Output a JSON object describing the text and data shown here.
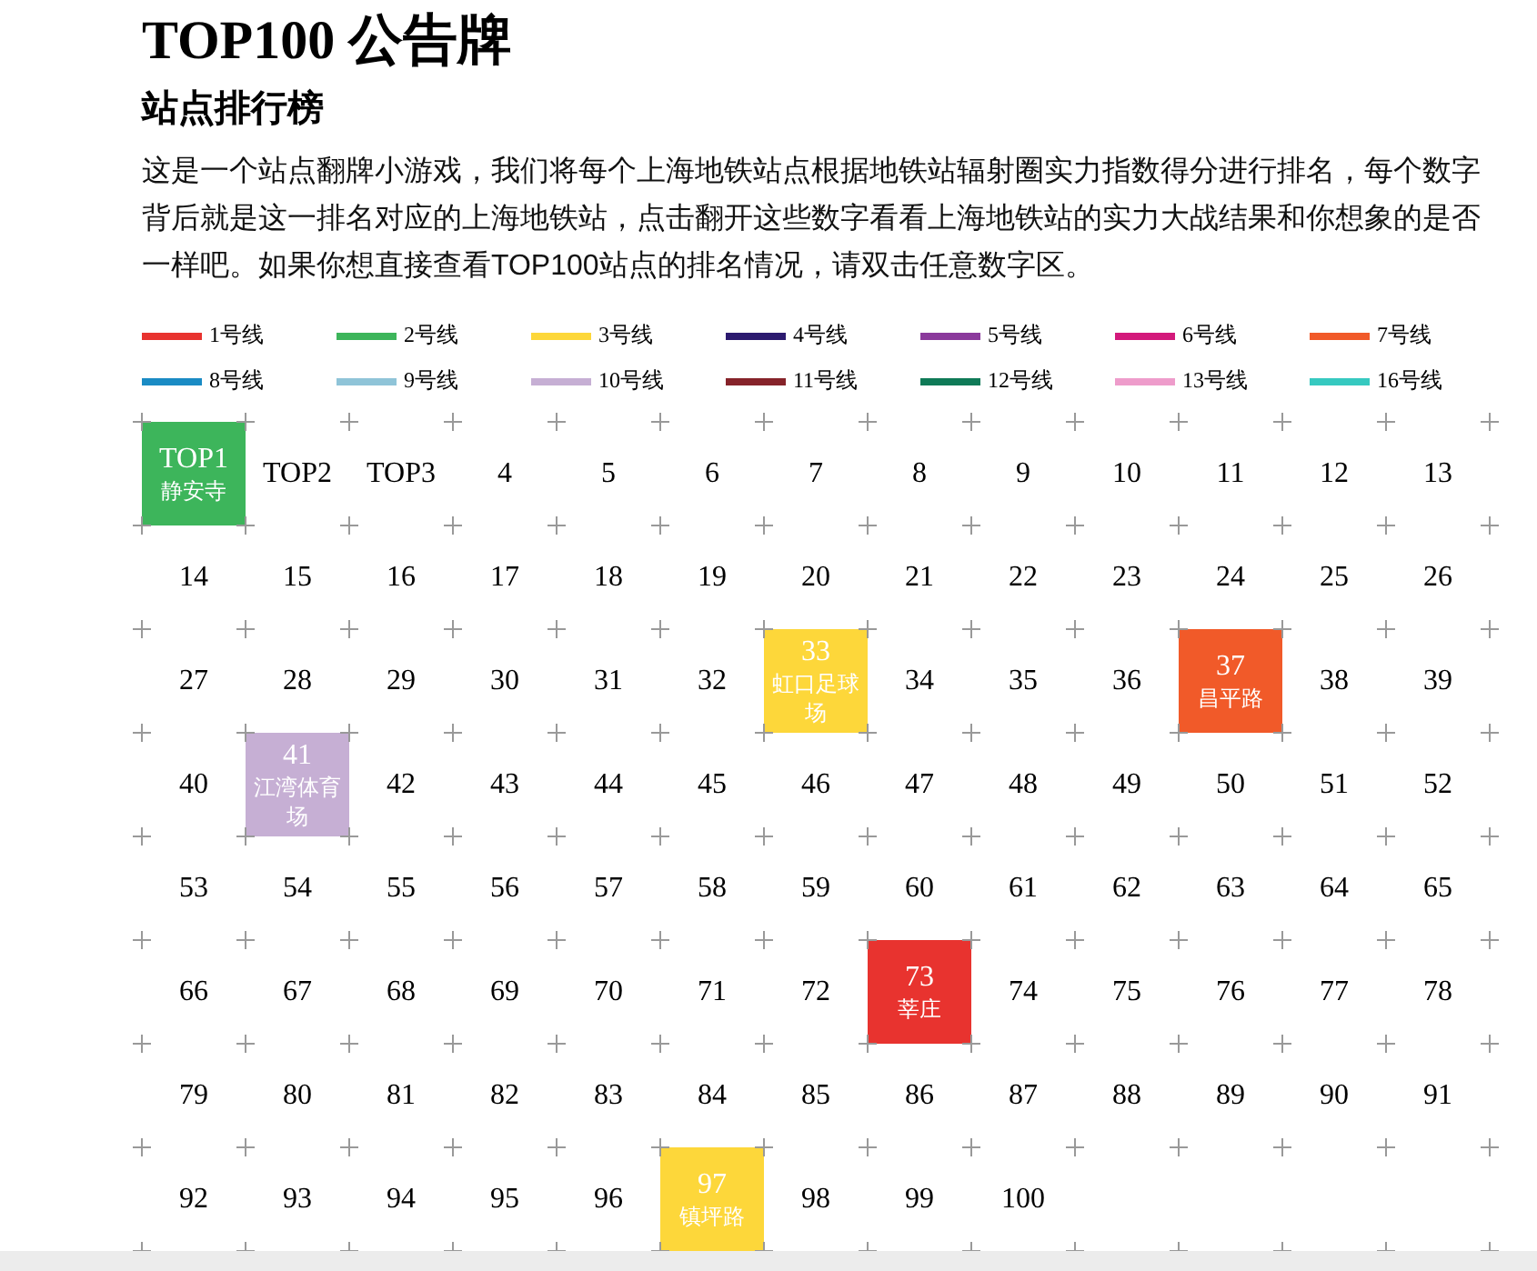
{
  "title": "TOP100 公告牌",
  "subtitle": "站点排行榜",
  "intro": "这是一个站点翻牌小游戏，我们将每个上海地铁站点根据地铁站辐射圈实力指数得分进行排名，每个数字背后就是这一排名对应的上海地铁站，点击翻开这些数字看看上海地铁站的实力大战结果和你想象的是否一样吧。如果你想直接查看TOP100站点的排名情况，请双击任意数字区。",
  "legend": [
    {
      "label": "1号线",
      "color": "#e8332f"
    },
    {
      "label": "2号线",
      "color": "#3db55b"
    },
    {
      "label": "3号线",
      "color": "#fdd73a"
    },
    {
      "label": "4号线",
      "color": "#2c1a6f"
    },
    {
      "label": "5号线",
      "color": "#8b3a9c"
    },
    {
      "label": "6号线",
      "color": "#d3197b"
    },
    {
      "label": "7号线",
      "color": "#f15a29"
    },
    {
      "label": "8号线",
      "color": "#1a8bc4"
    },
    {
      "label": "9号线",
      "color": "#8fc4d8"
    },
    {
      "label": "10号线",
      "color": "#c6afd4"
    },
    {
      "label": "11号线",
      "color": "#86232a"
    },
    {
      "label": "12号线",
      "color": "#0f7a57"
    },
    {
      "label": "13号线",
      "color": "#ee9ccb"
    },
    {
      "label": "16号线",
      "color": "#36c9c0"
    }
  ],
  "cells": [
    {
      "label": "TOP1",
      "revealed": true,
      "station": "静安寺",
      "color": "#3db55b"
    },
    {
      "label": "TOP2",
      "revealed": false
    },
    {
      "label": "TOP3",
      "revealed": false
    },
    {
      "label": "4",
      "revealed": false
    },
    {
      "label": "5",
      "revealed": false
    },
    {
      "label": "6",
      "revealed": false
    },
    {
      "label": "7",
      "revealed": false
    },
    {
      "label": "8",
      "revealed": false
    },
    {
      "label": "9",
      "revealed": false
    },
    {
      "label": "10",
      "revealed": false
    },
    {
      "label": "11",
      "revealed": false
    },
    {
      "label": "12",
      "revealed": false
    },
    {
      "label": "13",
      "revealed": false
    },
    {
      "label": "14",
      "revealed": false
    },
    {
      "label": "15",
      "revealed": false
    },
    {
      "label": "16",
      "revealed": false
    },
    {
      "label": "17",
      "revealed": false
    },
    {
      "label": "18",
      "revealed": false
    },
    {
      "label": "19",
      "revealed": false
    },
    {
      "label": "20",
      "revealed": false
    },
    {
      "label": "21",
      "revealed": false
    },
    {
      "label": "22",
      "revealed": false
    },
    {
      "label": "23",
      "revealed": false
    },
    {
      "label": "24",
      "revealed": false
    },
    {
      "label": "25",
      "revealed": false
    },
    {
      "label": "26",
      "revealed": false
    },
    {
      "label": "27",
      "revealed": false
    },
    {
      "label": "28",
      "revealed": false
    },
    {
      "label": "29",
      "revealed": false
    },
    {
      "label": "30",
      "revealed": false
    },
    {
      "label": "31",
      "revealed": false
    },
    {
      "label": "32",
      "revealed": false
    },
    {
      "label": "33",
      "revealed": true,
      "station": "虹口足球场",
      "color": "#fdd73a"
    },
    {
      "label": "34",
      "revealed": false
    },
    {
      "label": "35",
      "revealed": false
    },
    {
      "label": "36",
      "revealed": false
    },
    {
      "label": "37",
      "revealed": true,
      "station": "昌平路",
      "color": "#f15a29"
    },
    {
      "label": "38",
      "revealed": false
    },
    {
      "label": "39",
      "revealed": false
    },
    {
      "label": "40",
      "revealed": false
    },
    {
      "label": "41",
      "revealed": true,
      "station": "江湾体育场",
      "color": "#c6afd4"
    },
    {
      "label": "42",
      "revealed": false
    },
    {
      "label": "43",
      "revealed": false
    },
    {
      "label": "44",
      "revealed": false
    },
    {
      "label": "45",
      "revealed": false
    },
    {
      "label": "46",
      "revealed": false
    },
    {
      "label": "47",
      "revealed": false
    },
    {
      "label": "48",
      "revealed": false
    },
    {
      "label": "49",
      "revealed": false
    },
    {
      "label": "50",
      "revealed": false
    },
    {
      "label": "51",
      "revealed": false
    },
    {
      "label": "52",
      "revealed": false
    },
    {
      "label": "53",
      "revealed": false
    },
    {
      "label": "54",
      "revealed": false
    },
    {
      "label": "55",
      "revealed": false
    },
    {
      "label": "56",
      "revealed": false
    },
    {
      "label": "57",
      "revealed": false
    },
    {
      "label": "58",
      "revealed": false
    },
    {
      "label": "59",
      "revealed": false
    },
    {
      "label": "60",
      "revealed": false
    },
    {
      "label": "61",
      "revealed": false
    },
    {
      "label": "62",
      "revealed": false
    },
    {
      "label": "63",
      "revealed": false
    },
    {
      "label": "64",
      "revealed": false
    },
    {
      "label": "65",
      "revealed": false
    },
    {
      "label": "66",
      "revealed": false
    },
    {
      "label": "67",
      "revealed": false
    },
    {
      "label": "68",
      "revealed": false
    },
    {
      "label": "69",
      "revealed": false
    },
    {
      "label": "70",
      "revealed": false
    },
    {
      "label": "71",
      "revealed": false
    },
    {
      "label": "72",
      "revealed": false
    },
    {
      "label": "73",
      "revealed": true,
      "station": "莘庄",
      "color": "#e8332f"
    },
    {
      "label": "74",
      "revealed": false
    },
    {
      "label": "75",
      "revealed": false
    },
    {
      "label": "76",
      "revealed": false
    },
    {
      "label": "77",
      "revealed": false
    },
    {
      "label": "78",
      "revealed": false
    },
    {
      "label": "79",
      "revealed": false
    },
    {
      "label": "80",
      "revealed": false
    },
    {
      "label": "81",
      "revealed": false
    },
    {
      "label": "82",
      "revealed": false
    },
    {
      "label": "83",
      "revealed": false
    },
    {
      "label": "84",
      "revealed": false
    },
    {
      "label": "85",
      "revealed": false
    },
    {
      "label": "86",
      "revealed": false
    },
    {
      "label": "87",
      "revealed": false
    },
    {
      "label": "88",
      "revealed": false
    },
    {
      "label": "89",
      "revealed": false
    },
    {
      "label": "90",
      "revealed": false
    },
    {
      "label": "91",
      "revealed": false
    },
    {
      "label": "92",
      "revealed": false
    },
    {
      "label": "93",
      "revealed": false
    },
    {
      "label": "94",
      "revealed": false
    },
    {
      "label": "95",
      "revealed": false
    },
    {
      "label": "96",
      "revealed": false
    },
    {
      "label": "97",
      "revealed": true,
      "station": "镇坪路",
      "color": "#fdd73a"
    },
    {
      "label": "98",
      "revealed": false
    },
    {
      "label": "99",
      "revealed": false
    },
    {
      "label": "100",
      "revealed": false
    }
  ]
}
